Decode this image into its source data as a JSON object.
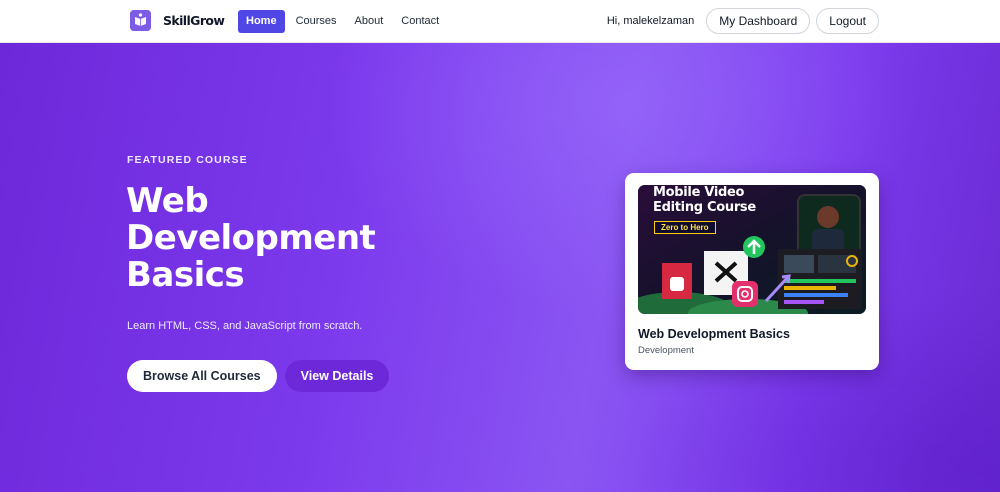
{
  "navbar": {
    "brand": "SkillGrow",
    "links": [
      {
        "label": "Home",
        "active": true
      },
      {
        "label": "Courses",
        "active": false
      },
      {
        "label": "About",
        "active": false
      },
      {
        "label": "Contact",
        "active": false
      }
    ],
    "greeting": "Hi, malekelzaman",
    "dashboard_label": "My Dashboard",
    "logout_label": "Logout"
  },
  "hero": {
    "eyebrow": "FEATURED COURSE",
    "title": "Web Development Basics",
    "subtitle": "Learn HTML, CSS, and JavaScript from scratch.",
    "browse_label": "Browse All Courses",
    "details_label": "View Details"
  },
  "card": {
    "thumbnail": {
      "line1": "Mobile Video",
      "line2": "Editing Course",
      "badge": "Zero to Hero"
    },
    "title": "Web Development Basics",
    "category": "Development"
  },
  "colors": {
    "accent": "#4f46e5",
    "hero_bg": "#7c3aed",
    "button_purple": "#6d28d9"
  }
}
